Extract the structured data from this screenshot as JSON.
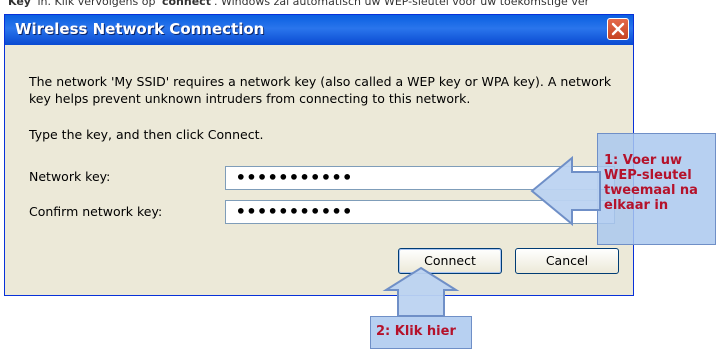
{
  "caption": {
    "key": "Key",
    "text1": "' in. Klik vervolgens op '",
    "connect": "connect",
    "text2": "'. Windows zal automatisch uw WEP-sleutel voor uw toekomstige ver"
  },
  "dialog": {
    "title": "Wireless Network Connection",
    "description": "The network 'My SSID' requires a network key (also called a WEP key or WPA key). A network key helps prevent unknown intruders from connecting to this network.",
    "instruction": "Type the key, and then click Connect.",
    "network_key_label": "Network key:",
    "network_key_value": "•••••••••••",
    "confirm_key_label": "Confirm network key:",
    "confirm_key_value": "•••••••••••",
    "connect_label": "Connect",
    "cancel_label": "Cancel"
  },
  "annotations": {
    "note1": "1: Voer uw\nWEP-sleutel\ntweemaal na\nelkaar in",
    "note2": "2: Klik hier"
  },
  "colors": {
    "titlebar": "#0a5fe0",
    "annotation_text": "#b5122b",
    "annotation_bg": "#aac8ee"
  }
}
